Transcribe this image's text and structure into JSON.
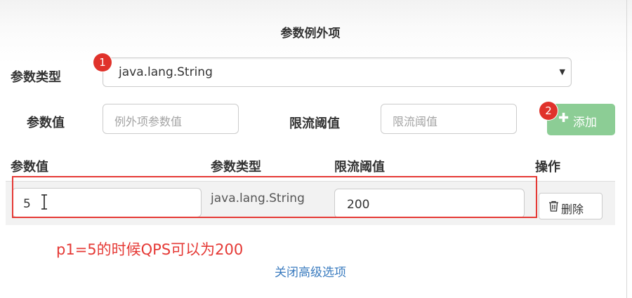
{
  "section": {
    "title": "参数例外项"
  },
  "form": {
    "param_type_label": "参数类型",
    "param_type_value": "java.lang.String",
    "param_value_label": "参数值",
    "param_value_placeholder": "例外项参数值",
    "threshold_label": "限流阈值",
    "threshold_placeholder": "限流阈值",
    "add_button_label": "添加",
    "add_button_icon": "plus-icon"
  },
  "annotations": {
    "badge_1": "1",
    "badge_2": "2",
    "note": "p1=5的时候QPS可以为200",
    "highlight_color": "#e53935"
  },
  "table": {
    "headers": [
      "参数值",
      "参数类型",
      "限流阈值",
      "操作"
    ],
    "rows": [
      {
        "param_value": "5",
        "param_type": "java.lang.String",
        "threshold": "200",
        "delete_label": "删除",
        "delete_icon": "trash-icon"
      }
    ]
  },
  "footer": {
    "toggle_label": "关闭高级选项"
  },
  "colors": {
    "add_button_bg": "#8ccd95",
    "badge": "#e0322b",
    "link": "#3a7bbf"
  }
}
